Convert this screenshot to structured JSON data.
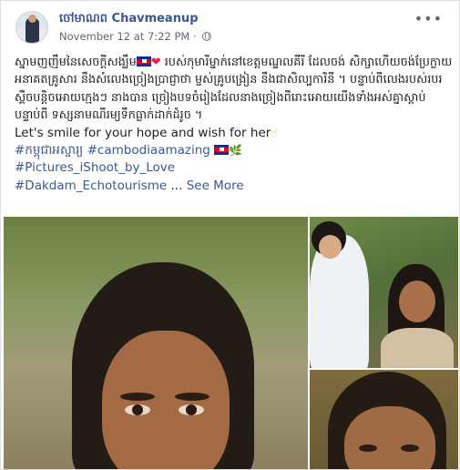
{
  "post": {
    "author": "ចៅមាណព Chavmeanup",
    "timestamp": "November 12 at 7:22 PM",
    "separator": "·",
    "privacy_icon": "globe-icon",
    "more_icon": "more-options-icon",
    "more_label": "•••"
  },
  "body": {
    "khmer_lines": [
      "ស្នាមញញឹមនៃសេចក្តីសង្ឃឹម",
      "របស់កុមារីម្នាក់នៅខេត្តមណ្ឌលគីរី ដែលចង់",
      "សិក្សាហើយចង់ប្រែក្លាយអនាគតគ្រូសារ នឹងសំលេងច្រៀងប្រាជ្ញាថា ម្ចស់គ្រូបង្រៀន",
      "នឹងជាសិល្បការិនី ។ បន្ទាប់ពីលេងរបស់របរស្ពឺចបន្តិចអោយក្មេងៗ នាងបាន",
      "ច្រៀងបទចំរៀងដែលនាងច្រៀងពីរោះអោយយើងទាំងអស់គ្នាស្តាប់ បន្ទាប់ពី",
      "ទស្សនាមណីរម្យទឹកធ្លាក់ដាក់ដំរូច ។"
    ],
    "english_line": "Let's smile for your hope and wish for her",
    "hashtag_khmer": "#កម្ពុជាអស្ចារ្យ",
    "hashtag_1": "#cambodiaamazing",
    "hashtag_2": "#Pictures_iShoot_by_Love",
    "hashtag_3": "#Dakdam_Echotourisme",
    "ellipsis": "...",
    "see_more": "See More",
    "emoji": {
      "heart": "❤",
      "hand": "☝",
      "leaf": "🌿"
    }
  },
  "photos": {
    "main": "girl-portrait-photo",
    "top_right": "two-girls-photo",
    "bottom_right": "girl-closeup-photo"
  },
  "colors": {
    "link": "#385898",
    "text": "#1c1e21",
    "meta": "#616770"
  }
}
